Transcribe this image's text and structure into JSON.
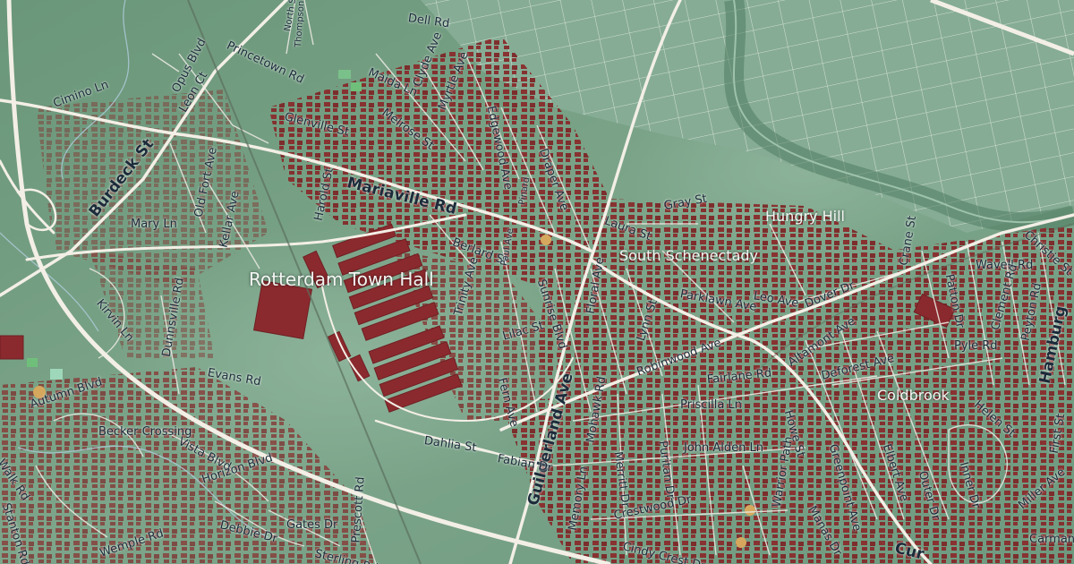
{
  "map": {
    "colors": {
      "land": "#6f9a80",
      "land_dark": "#5b8a6c",
      "land_light": "#8fb39d",
      "building": "#8a2d2d",
      "road": "#f3efe6",
      "road_minor": "#e7e7df",
      "label_text": "#1c2b3a"
    },
    "places": {
      "rotterdam_town_hall": "Rotterdam Town Hall",
      "south_schenectady": "South Schenectady",
      "hungry_hill": "Hungry Hill",
      "coldbrook": "Coldbrook"
    },
    "streets": {
      "burdeck": "Burdeck St",
      "mariaville": "Mariaville Rd",
      "guilderland": "Guilderland Ave",
      "princetown": "Princetown Rd",
      "glenville": "Glenville St",
      "melrose": "Melrose St",
      "myrtle": "Myrtle Ave",
      "clyde": "Clyde Ave",
      "maida": "Maida Ln",
      "edgewood": "Edgewood Ave",
      "draper": "Draper Ave",
      "opus": "Opus Blvd",
      "cimino": "Cimino Ln",
      "leon": "Leon Ct",
      "old_fort": "Old Fort Ave",
      "kellar": "Kellar Ave",
      "mary": "Mary Ln",
      "harold": "Harold St",
      "berlard": "Berlard St",
      "laura": "Laura St",
      "gray": "Gray St",
      "sunrise": "Sunrise Blvd",
      "floral": "Floral Ave",
      "trinity": "Trinity Ave",
      "lilac": "Lilac St",
      "fern": "Fern Ave",
      "lynn": "Lynn St",
      "parklawn": "Parklawn Ave",
      "leo": "Leo Ave",
      "robinwood": "Robinwood Ave",
      "dover": "Dover Dr",
      "altamont": "Altamont Ave",
      "deforest": "Deforest Ave",
      "crane": "Crane St",
      "patton": "Patton Dr",
      "pyle": "Pyle Rd",
      "wavell": "Wavell Rd",
      "clement": "Clement Rd",
      "peyton": "Peyton Rd",
      "hamburg": "Hamburg",
      "christie": "Christie St",
      "helen": "Helen St",
      "kirvin": "Kirvin Ln",
      "dunnsville": "Dunnsville Rd",
      "evans": "Evans Rd",
      "autumn": "Autumn Blvd",
      "becker": "Becker Crossing",
      "vista": "Vista Blvd",
      "horizon": "Horizon Blvd",
      "walk": "Walk Rd",
      "stanton": "Stanton Rd",
      "dahlia": "Dahlia St",
      "fabian": "Fabian Dr",
      "merritt": "Merritt Dr",
      "puritan": "Puritan Dr",
      "priscilla": "Priscilla Ln",
      "fairlane": "Fairlane Rd",
      "john_alden": "John Alden Ln",
      "memory": "Memory Ln",
      "crestwood": "Crestwood Dr",
      "warrior": "Warrior Path",
      "mohawk": "Mohawk Rd",
      "cindy": "Cindy Crest Dr",
      "mansion": "Manas Dr",
      "greenpoint": "Greenpoint Ave",
      "elbert": "Elbert Ave",
      "outer": "Outer Dr",
      "inner": "Inner Dr",
      "howe": "Howe St",
      "miller": "Miller Ave",
      "wemple": "Wemple Rd",
      "debbie": "Debbie Dr",
      "gates": "Gates Dr",
      "sterling": "Sterling Rd",
      "prescott": "Prescott Rd",
      "dell": "Dell Rd",
      "north": "North St",
      "thompson": "Thompson St",
      "carman": "Carman",
      "cur": "Cur",
      "first": "First St",
      "pinard": "Pinard",
      "paul": "Paul Ave"
    }
  }
}
